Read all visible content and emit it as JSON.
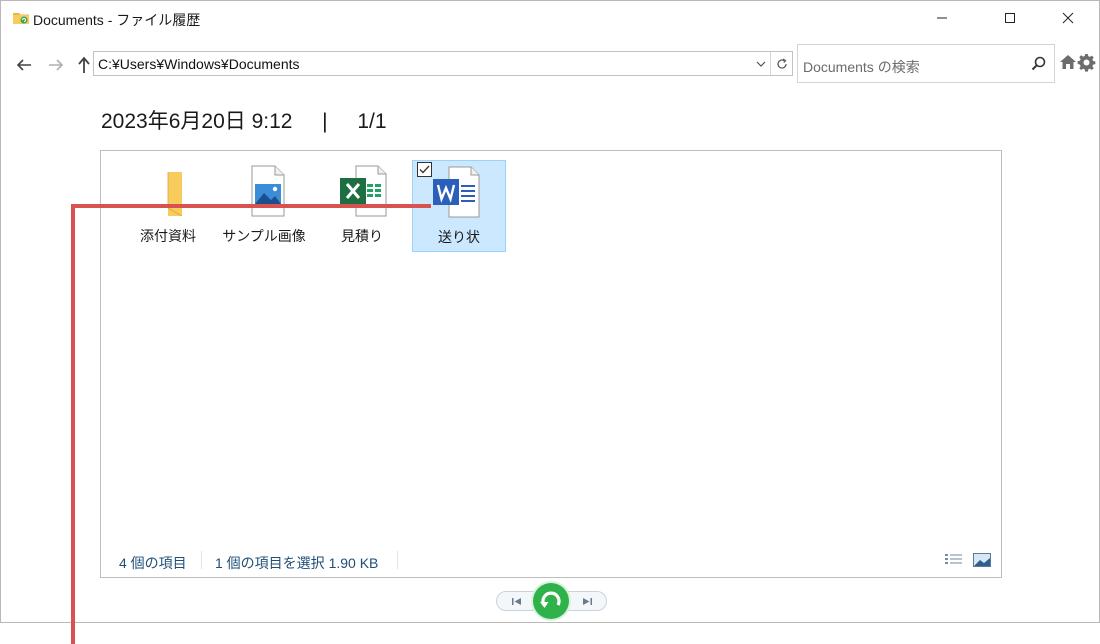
{
  "window": {
    "title": "Documents - ファイル履歴"
  },
  "address": {
    "path": "C:¥Users¥Windows¥Documents"
  },
  "search": {
    "placeholder": "Documents の検索"
  },
  "heading": {
    "date_time": "2023年6月20日 9:12",
    "separator": "|",
    "page": "1/1"
  },
  "items": [
    {
      "label": "添付資料",
      "icon": "folder-icon",
      "selected": false
    },
    {
      "label": "サンプル画像",
      "icon": "image-file-icon",
      "selected": false
    },
    {
      "label": "見積り",
      "icon": "excel-file-icon",
      "selected": false
    },
    {
      "label": "送り状",
      "icon": "word-file-icon",
      "selected": true
    }
  ],
  "status": {
    "count": "4 個の項目",
    "selection": "1 個の項目を選択  1.90 KB"
  },
  "colors": {
    "selection_bg": "#cce8ff",
    "restore_button": "#2fb24a",
    "callout": "#d8534f",
    "excel_green": "#1d6f42",
    "word_blue": "#2b5fb9",
    "folder_yellow": "#f8cc5c"
  }
}
